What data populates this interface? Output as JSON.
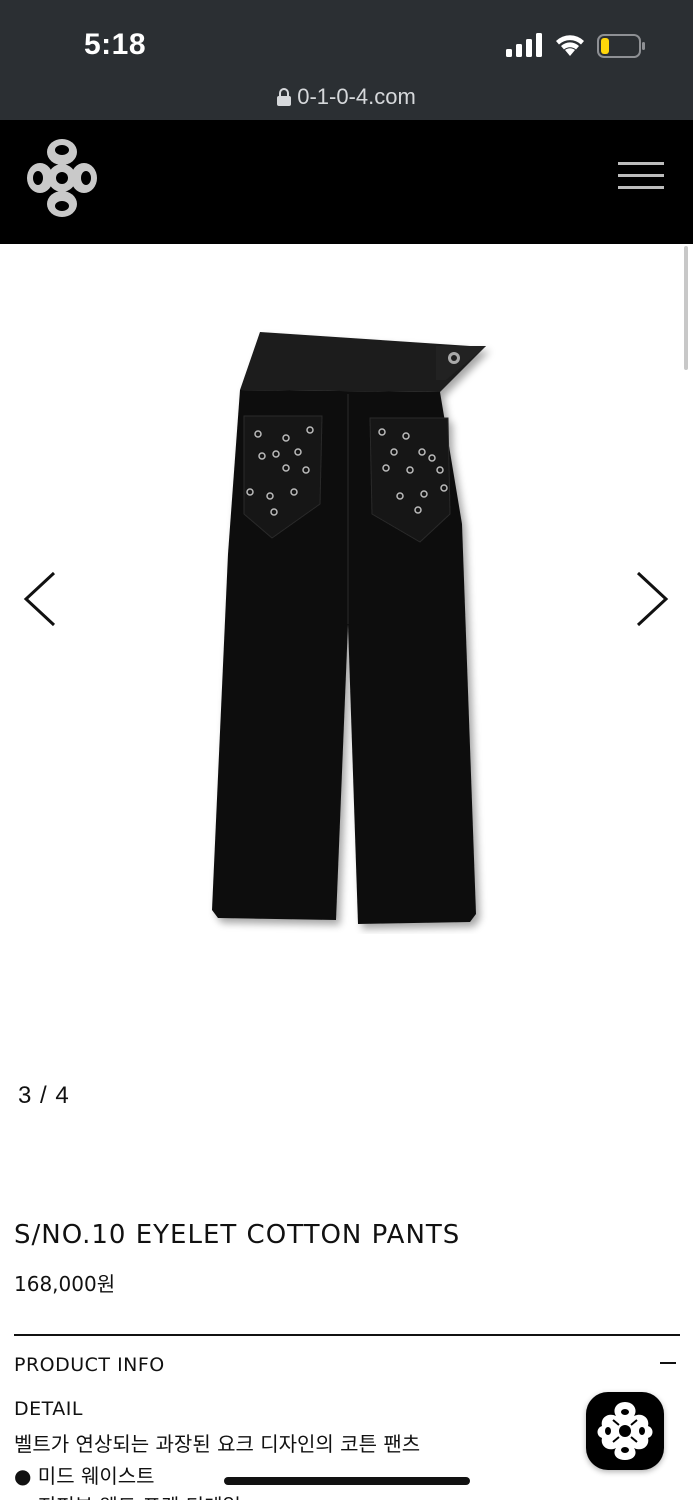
{
  "status_bar": {
    "time": "5:18",
    "signal_icon": "cellular-signal-icon",
    "wifi_icon": "wifi-icon",
    "battery_icon": "battery-low-icon",
    "battery_color": "#ffd60a"
  },
  "browser": {
    "url": "0-1-0-4.com",
    "lock_icon": "lock-icon"
  },
  "header": {
    "logo_icon": "brand-logo-icon",
    "menu_icon": "hamburger-menu-icon",
    "background": "#000000"
  },
  "gallery": {
    "current": "3 / 4",
    "prev_icon": "chevron-left-icon",
    "next_icon": "chevron-right-icon",
    "image_icon": "black-pants-image"
  },
  "product": {
    "name": "S/NO.10 EYELET COTTON PANTS",
    "price": "168,000원"
  },
  "info": {
    "section_title": "PRODUCT INFO",
    "detail_label": "DETAIL",
    "description": "벨트가 연상되는 과장된 요크 디자인의 코튼 팬츠",
    "bullets": [
      "● 미드 웨이스트",
      "● 지퍼부 웨드 포켓 디테일"
    ]
  },
  "fab": {
    "icon": "brand-chat-icon"
  }
}
